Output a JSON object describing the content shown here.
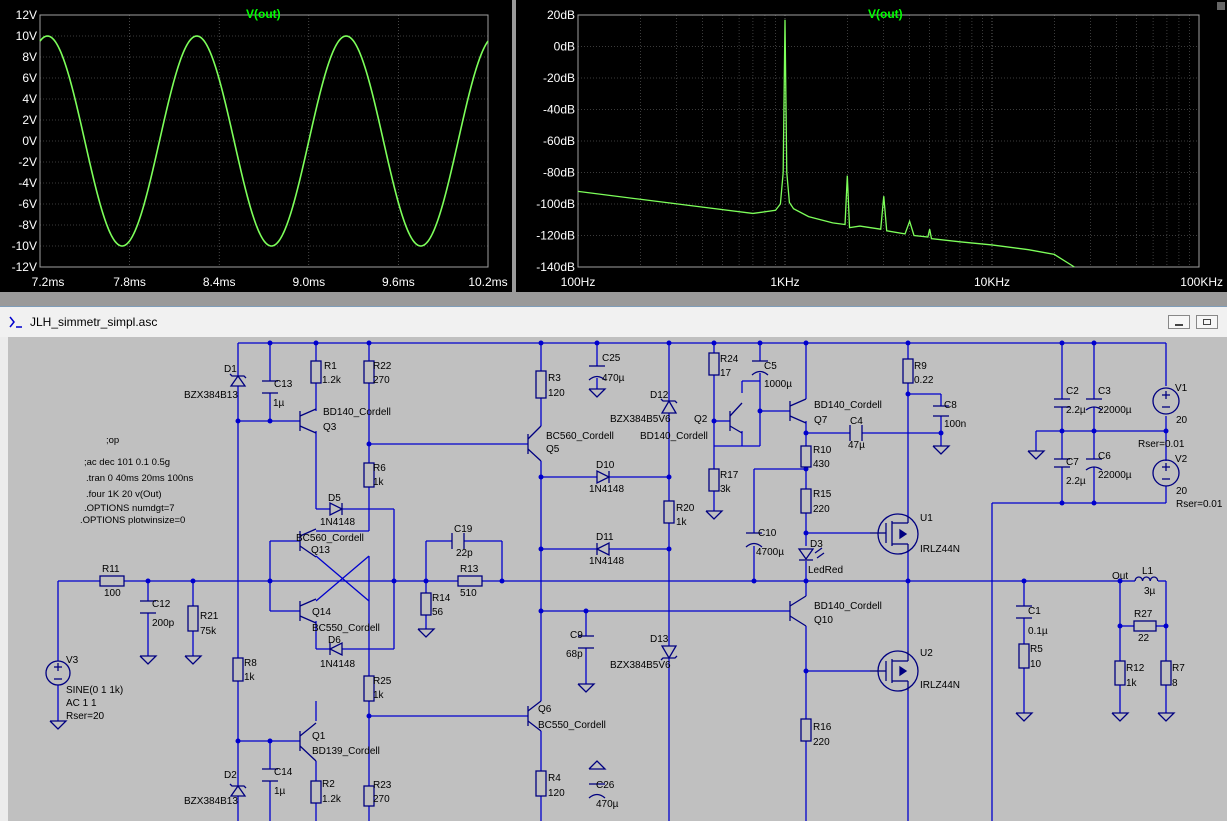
{
  "waveform_plot": {
    "title": "V(out)",
    "y_ticks": [
      "12V",
      "10V",
      "8V",
      "6V",
      "4V",
      "2V",
      "0V",
      "-2V",
      "-4V",
      "-6V",
      "-8V",
      "-10V",
      "-12V"
    ],
    "x_ticks": [
      "7.2ms",
      "7.8ms",
      "8.4ms",
      "9.0ms",
      "9.6ms",
      "10.2ms"
    ],
    "trace_color": "#7dff5a"
  },
  "fft_plot": {
    "title": "V(out)",
    "y_ticks": [
      "20dB",
      "0dB",
      "-20dB",
      "-40dB",
      "-60dB",
      "-80dB",
      "-100dB",
      "-120dB",
      "-140dB"
    ],
    "x_ticks": [
      "100Hz",
      "1KHz",
      "10KHz",
      "100KHz"
    ],
    "trace_color": "#7dff5a"
  },
  "chart_data": [
    {
      "type": "line",
      "title": "V(out)",
      "xlabel": "",
      "ylabel": "",
      "x_unit": "ms",
      "y_unit": "V",
      "xlim": [
        7.2,
        10.2
      ],
      "ylim": [
        -12,
        12
      ],
      "grid": true,
      "series": [
        {
          "name": "V(out)",
          "waveform": "sine",
          "amplitude": 10,
          "frequency_hz": 1000,
          "peak_time_ms": 7.25
        }
      ],
      "points_x": [
        7.25,
        7.75,
        8.25,
        8.75,
        9.25,
        9.75,
        10.2
      ],
      "points_y": [
        10,
        -10,
        10,
        -10,
        10,
        -10,
        9.6
      ]
    },
    {
      "type": "line",
      "title": "V(out)",
      "xlabel": "",
      "ylabel": "",
      "x_scale": "log",
      "xlim": [
        100,
        100000
      ],
      "ylim": [
        -140,
        20
      ],
      "grid": true,
      "series": [
        {
          "name": "V(out)",
          "x": [
            100,
            200,
            400,
            700,
            900,
            950,
            980,
            1000,
            1020,
            1050,
            1100,
            1300,
            1700,
            1950,
            2000,
            2050,
            2300,
            2900,
            3000,
            3100,
            3800,
            4000,
            4200,
            4900,
            5000,
            5100,
            7000,
            10000,
            15000,
            20000,
            25000
          ],
          "y": [
            -92,
            -97,
            -102,
            -106,
            -104,
            -100,
            -80,
            17,
            -80,
            -99,
            -103,
            -108,
            -112,
            -113,
            -82,
            -115,
            -114,
            -116,
            -95,
            -117,
            -119,
            -111,
            -120,
            -121,
            -116,
            -122,
            -124,
            -126,
            -129,
            -132,
            -140
          ]
        }
      ]
    }
  ],
  "schematic_window": {
    "title": "JLH_simmetr_simpl.asc",
    "minimize_label": "—",
    "restore_label": "▭"
  },
  "directives": [
    ";op",
    ";ac dec 101 0.1 0.5g",
    ".tran 0 40ms 20ms 100ns",
    ".four 1K 20 v(Out)",
    ".OPTIONS numdgt=7",
    ".OPTIONS plotwinsize=0"
  ],
  "components": {
    "D1": "BZX384B13",
    "C13": "1µ",
    "R1": "1.2k",
    "R22": "270",
    "Q3": "BD140_Cordell",
    "R6": "1k",
    "D5": "1N4148",
    "Q13": "BC560_Cordell",
    "Q14": "BC550_Cordell",
    "D6": "1N4148",
    "R11": "100",
    "C12": "200p",
    "R21": "75k",
    "R14": "56",
    "C19": "22p",
    "R13": "510",
    "R8": "1k",
    "R25": "1k",
    "Q1": "BD139_Cordell",
    "C14": "1µ",
    "D2": "BZX384B13",
    "R2": "1.2k",
    "R23": "270",
    "R3": "120",
    "Q5": "BC560_Cordell",
    "C25": "470µ",
    "D10": "1N4148",
    "D11": "1N4148",
    "D12": "BZX384B5V6",
    "D12b": "BD140_Cordell",
    "R20": "1k",
    "C9": "68p",
    "D13": "BZX384B5V6",
    "Q6": "BC550_Cordell",
    "R4": "120",
    "C26": "470µ",
    "R24": "17",
    "C5": "1000µ",
    "Q7": "BD140_Cordell",
    "R17": "3k",
    "C4": "47µ",
    "R10": "430",
    "R15": "220",
    "C10": "4700µ",
    "D3": "LedRed",
    "Q10": "BD140_Cordell",
    "R16": "220",
    "R9": "0.22",
    "C8": "100n",
    "U1": "IRLZ44N",
    "U2": "IRLZ44N",
    "C2": "2.2µ",
    "C3": "22000µ",
    "C7": "2.2µ",
    "C6": "22000µ",
    "V1": "20",
    "V2": "20",
    "C1": "0.1µ",
    "R5": "10",
    "L1": "3µ",
    "R27": "22",
    "R12": "1k",
    "R7": "8"
  },
  "source_v3": {
    "name": "V3",
    "line1": "SINE(0 1 1k)",
    "line2": "AC 1 1",
    "line3": "Rser=20"
  },
  "v1_rser": "Rser=0.01",
  "v2_rser": "Rser=0.01",
  "net_out": "Out",
  "colors": {
    "wire": "#0000cd",
    "component": "#000080",
    "plot_bg": "#000000",
    "grid": "#777777",
    "trace": "#7dff5a",
    "schematic_bg": "#c0c0c0"
  }
}
